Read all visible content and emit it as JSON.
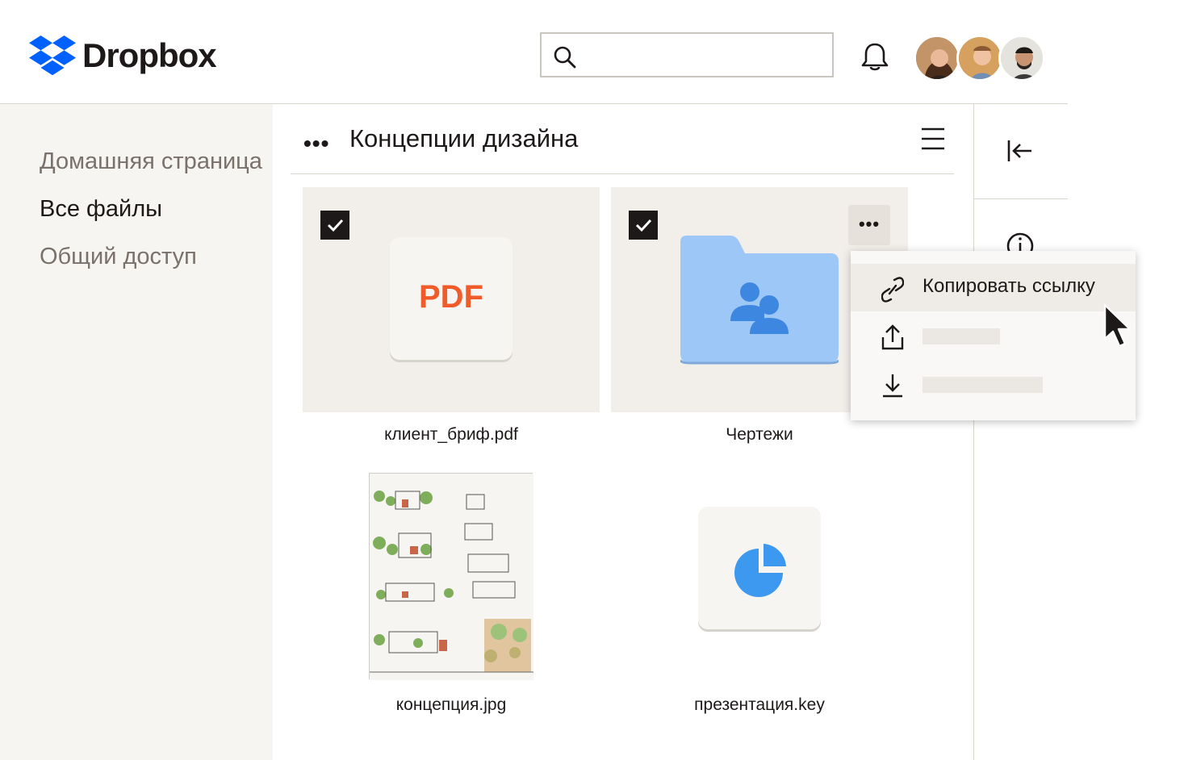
{
  "app": {
    "brand": "Dropbox",
    "accent": "#0061fe",
    "pdf_color": "#f05b2a",
    "folder_color": "#9dc7f7"
  },
  "search": {
    "placeholder": "",
    "icon": "search-icon"
  },
  "header": {
    "bell_icon": "bell-icon",
    "avatars": [
      "avatar-1",
      "avatar-2",
      "avatar-3"
    ]
  },
  "sidebar": {
    "items": [
      {
        "label": "Домашняя страница",
        "active": false
      },
      {
        "label": "Все файлы",
        "active": true
      },
      {
        "label": "Общий доступ",
        "active": false
      }
    ]
  },
  "main": {
    "breadcrumb_dots": "•••",
    "title": "Концепции дизайна",
    "files": [
      {
        "name": "клиент_бриф.pdf",
        "icon_label": "PDF",
        "checked": true
      },
      {
        "name": "Чертежи",
        "checked": true
      },
      {
        "name": "концепция.jpg"
      },
      {
        "name": "презентация.key"
      }
    ],
    "more_dots": "•••"
  },
  "context_menu": {
    "items": [
      {
        "label": "Копировать ссылку",
        "icon": "link-icon"
      },
      {
        "label": "",
        "icon": "share-icon"
      },
      {
        "label": "",
        "icon": "download-icon"
      }
    ]
  }
}
